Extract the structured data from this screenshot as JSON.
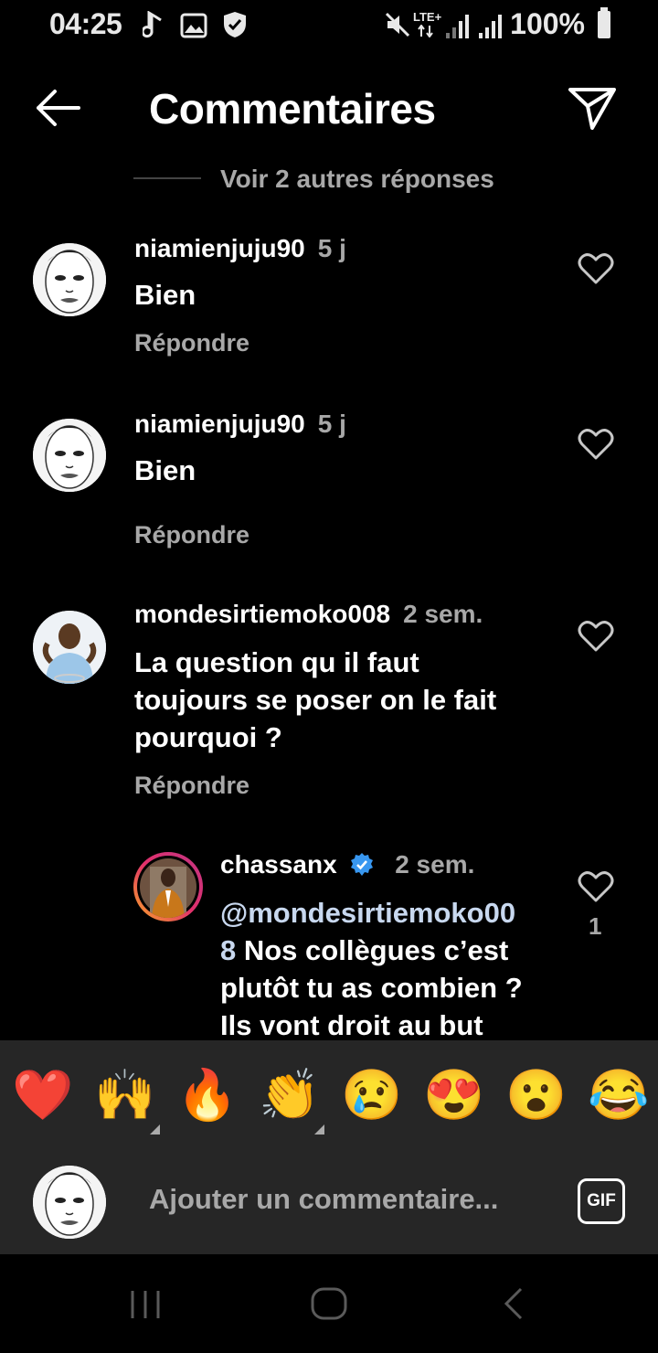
{
  "status_bar": {
    "time": "04:25",
    "network": "LTE+",
    "battery": "100%",
    "icons": [
      "music-note-icon",
      "image-icon",
      "shield-icon",
      "mute-icon",
      "signal-icon",
      "signal-icon",
      "battery-icon"
    ]
  },
  "header": {
    "title": "Commentaires",
    "back_icon": "arrow-left-icon",
    "send_icon": "paper-plane-icon"
  },
  "thread": {
    "more_replies": "Voir 2 autres réponses"
  },
  "comments": [
    {
      "username": "niamienjuju90",
      "time": "5 j",
      "text": "Bien",
      "reply": "Répondre"
    },
    {
      "username": "niamienjuju90",
      "time": "5 j",
      "text": "Bien",
      "reply": "Répondre"
    },
    {
      "username": "mondesirtiemoko008",
      "time": "2 sem.",
      "text_lines": [
        "La question qu il faut",
        "toujours se poser on le fait",
        "pourquoi ?"
      ],
      "reply": "Répondre"
    },
    {
      "username": "chassanx",
      "verified": true,
      "time": "2 sem.",
      "mention_line1": "@mondesirtiemoko00",
      "mention_line2": "8",
      "text_line2": " Nos collègues c’est",
      "text_line3": "plutôt tu as combien ?",
      "text_line4": "Ils vont droit au but",
      "likes": "1"
    }
  ],
  "emoji_bar": {
    "emojis": [
      "❤️",
      "🙌",
      "🔥",
      "👏",
      "😢",
      "😍",
      "😮",
      "😂"
    ]
  },
  "composer": {
    "placeholder": "Ajouter un commentaire...",
    "gif_label": "GIF"
  },
  "colors": {
    "background": "#000000",
    "secondary_text": "#a8a8a8",
    "panel": "#262626",
    "verified": "#3897f0",
    "mention": "#c8d8ef"
  }
}
